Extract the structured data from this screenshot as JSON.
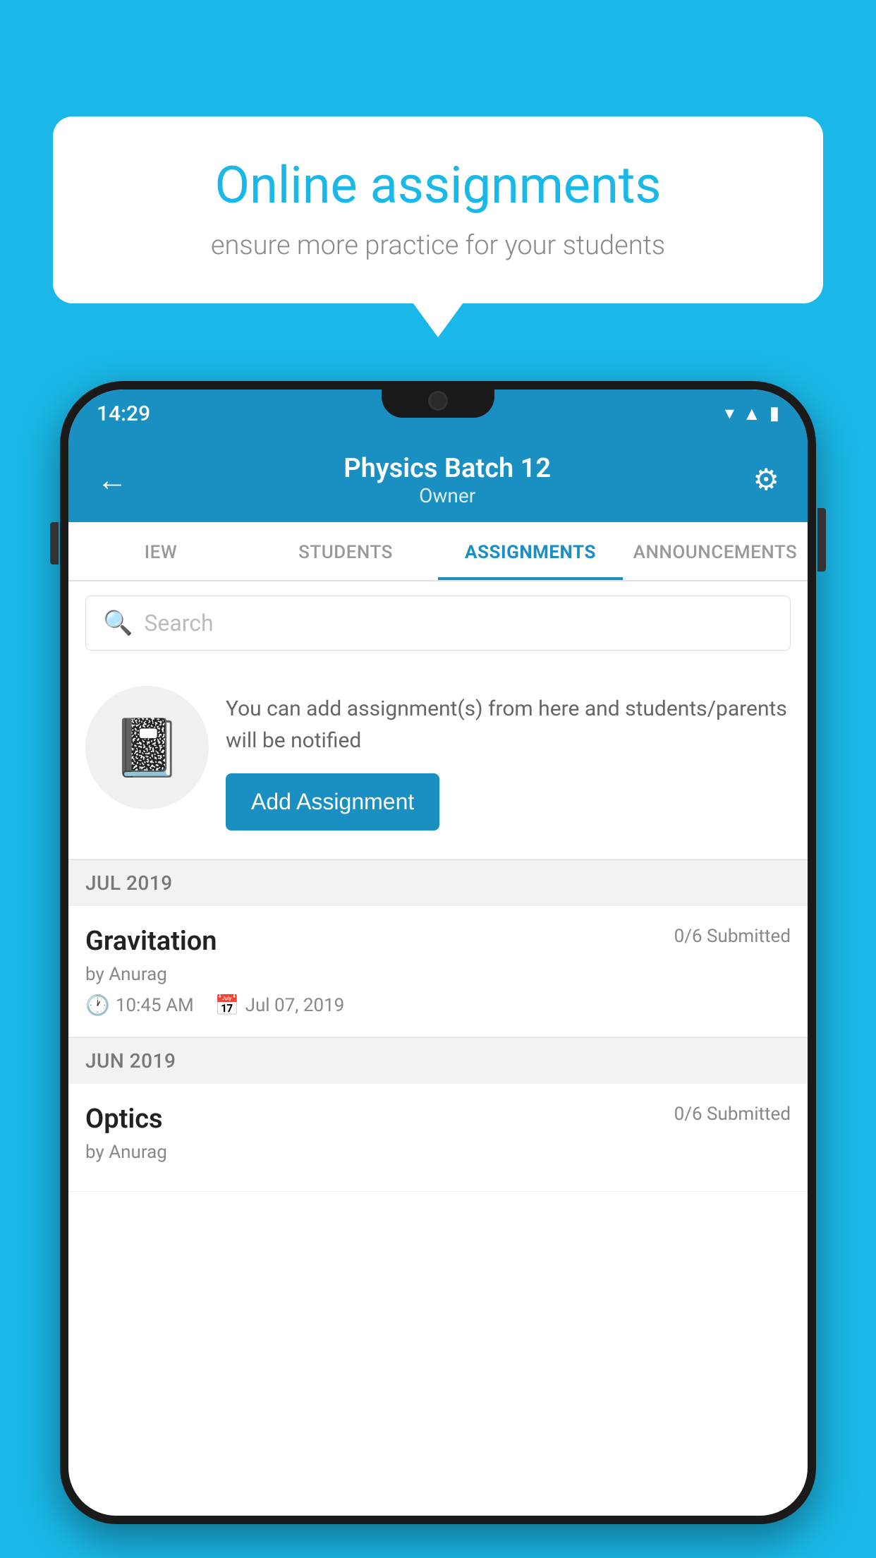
{
  "background_color": "#1ab8e8",
  "speech_bubble": {
    "title": "Online assignments",
    "subtitle": "ensure more practice for your students"
  },
  "phone": {
    "status_bar": {
      "time": "14:29",
      "icons": [
        "wifi",
        "signal",
        "battery"
      ]
    },
    "app_bar": {
      "title": "Physics Batch 12",
      "subtitle": "Owner",
      "back_label": "←",
      "settings_label": "⚙"
    },
    "tabs": [
      {
        "label": "IEW",
        "active": false
      },
      {
        "label": "STUDENTS",
        "active": false
      },
      {
        "label": "ASSIGNMENTS",
        "active": true
      },
      {
        "label": "ANNOUNCEMENTS",
        "active": false
      }
    ],
    "search": {
      "placeholder": "Search"
    },
    "promo": {
      "text": "You can add assignment(s) from here and students/parents will be notified",
      "button_label": "Add Assignment"
    },
    "assignment_sections": [
      {
        "month": "JUL 2019",
        "assignments": [
          {
            "name": "Gravitation",
            "submitted": "0/6 Submitted",
            "author": "by Anurag",
            "time": "10:45 AM",
            "date": "Jul 07, 2019"
          }
        ]
      },
      {
        "month": "JUN 2019",
        "assignments": [
          {
            "name": "Optics",
            "submitted": "0/6 Submitted",
            "author": "by Anurag",
            "time": "",
            "date": ""
          }
        ]
      }
    ]
  }
}
